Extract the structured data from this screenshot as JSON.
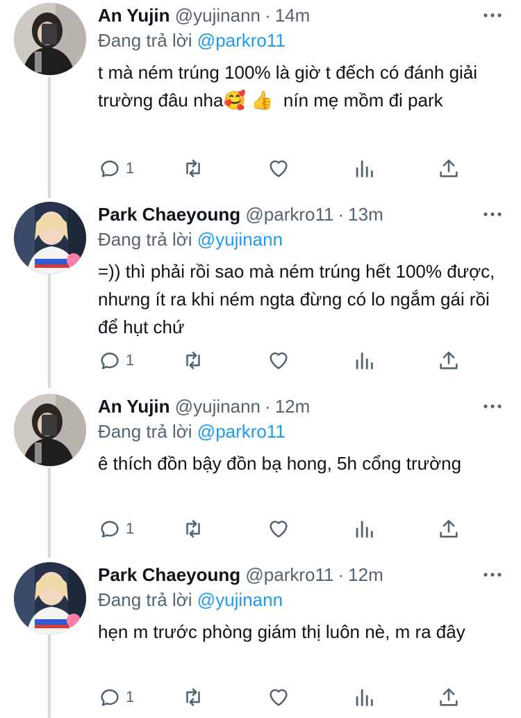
{
  "reply_prefix": "Đang trả lời",
  "tweets": [
    {
      "name": "An Yujin",
      "handle": "@yujinann",
      "time": "14m",
      "reply_to": "@parkro11",
      "text": "t mà ném trúng 100% là giờ t đếch có đánh giải trường đâu nha🥰 👍  nín mẹ mồm đi park",
      "reply_count": "1"
    },
    {
      "name": "Park Chaeyoung",
      "handle": "@parkro11",
      "time": "13m",
      "reply_to": "@yujinann",
      "text": "=)) thì phải rồi sao mà ném trúng hết 100% được, nhưng ít ra khi ném ngta đừng có lo ngắm gái rồi để hụt chứ",
      "reply_count": "1"
    },
    {
      "name": "An Yujin",
      "handle": "@yujinann",
      "time": "12m",
      "reply_to": "@parkro11",
      "text": "ê thích đồn bậy đồn bạ hong, 5h cổng trường",
      "reply_count": "1"
    },
    {
      "name": "Park Chaeyoung",
      "handle": "@parkro11",
      "time": "12m",
      "reply_to": "@yujinann",
      "text": "hẹn m trước phòng giám thị luôn nè, m ra đây",
      "reply_count": "1"
    }
  ],
  "colors": {
    "link": "#1d9bf0",
    "secondary": "#536471",
    "thread_line": "#cfd9de"
  },
  "icons": [
    "more-icon",
    "reply-icon",
    "retweet-icon",
    "like-icon",
    "views-icon",
    "share-icon"
  ]
}
